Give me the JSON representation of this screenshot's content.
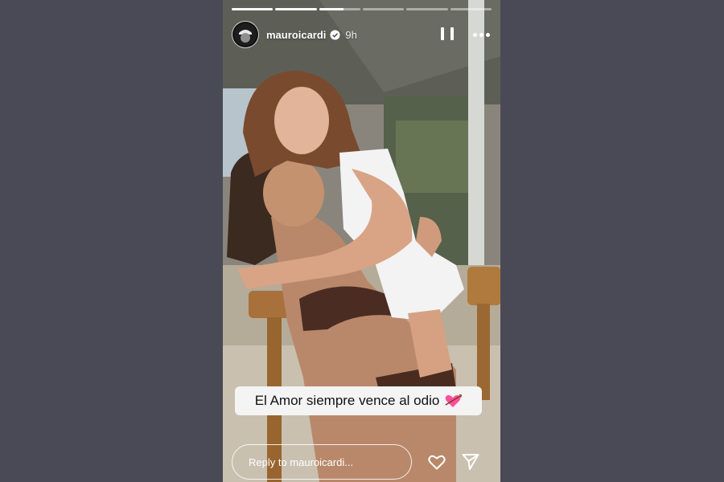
{
  "story": {
    "progress": [
      1,
      1,
      0.6,
      0,
      0,
      0
    ],
    "username": "mauroicardi",
    "verified": true,
    "time": "9h",
    "icons": {
      "avatar": "avatar-icon",
      "verified": "verified-badge-icon",
      "pause": "pause-icon",
      "more": "more-options-icon",
      "like": "heart-icon",
      "share": "send-icon"
    },
    "caption": "El Amor siempre vence al odio",
    "caption_emoji": "heart-with-arrow",
    "reply_placeholder": "Reply to mauroicardi..."
  },
  "colors": {
    "page_background": "#4a4a57",
    "caption_background": "#f4f4f4",
    "emoji_pink": "#ff4f9a"
  }
}
